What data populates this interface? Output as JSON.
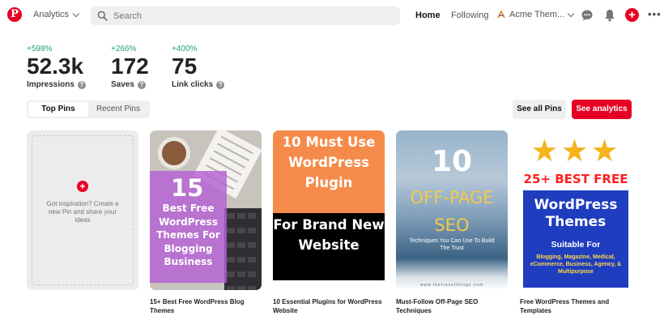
{
  "nav": {
    "logo": "P",
    "section_label": "Analytics",
    "search_placeholder": "Search",
    "home_label": "Home",
    "following_label": "Following",
    "account_label": "Acme Them...",
    "create_glyph": "+",
    "more_glyph": "•••"
  },
  "stats": [
    {
      "delta": "+598%",
      "value": "52.3k",
      "label": "Impressions"
    },
    {
      "delta": "+266%",
      "value": "172",
      "label": "Saves"
    },
    {
      "delta": "+400%",
      "value": "75",
      "label": "Link clicks"
    }
  ],
  "help_glyph": "?",
  "tabs": {
    "top": "Top Pins",
    "recent": "Recent Pins"
  },
  "buttons": {
    "see_all": "See all Pins",
    "see_analytics": "See analytics"
  },
  "create_card": {
    "plus": "+",
    "text": "Got inspiration? Create a new Pin and share your ideas"
  },
  "pins": [
    {
      "caption": "15+ Best Free WordPress Blog Themes",
      "image_number": "15",
      "image_text": "Best Free WordPress Themes For Blogging Business"
    },
    {
      "caption": "10 Essential Plugins for WordPress Website",
      "image_top_text": "10 Must Use WordPress Plugin",
      "image_bottom_text": "For Brand New Website"
    },
    {
      "caption": "Must-Follow Off-Page SEO Techniques",
      "image_number": "10",
      "image_title": "OFF-PAGE SEO",
      "image_subtitle": "Techniques You Can Use To Build The Trust",
      "image_url": "www.thetravelthings.com"
    },
    {
      "caption": "Free WordPress Themes and Templates",
      "image_stars": "★★★",
      "image_heading": "25+ BEST FREE",
      "image_title": "WordPress Themes",
      "image_subtitle": "Suitable For",
      "image_tags": "Blogging, Magazine, Medical, eCommerce, Business, Agency, & Multipurpose"
    }
  ],
  "colors": {
    "brand": "#e60023",
    "positive": "#23a36d"
  }
}
